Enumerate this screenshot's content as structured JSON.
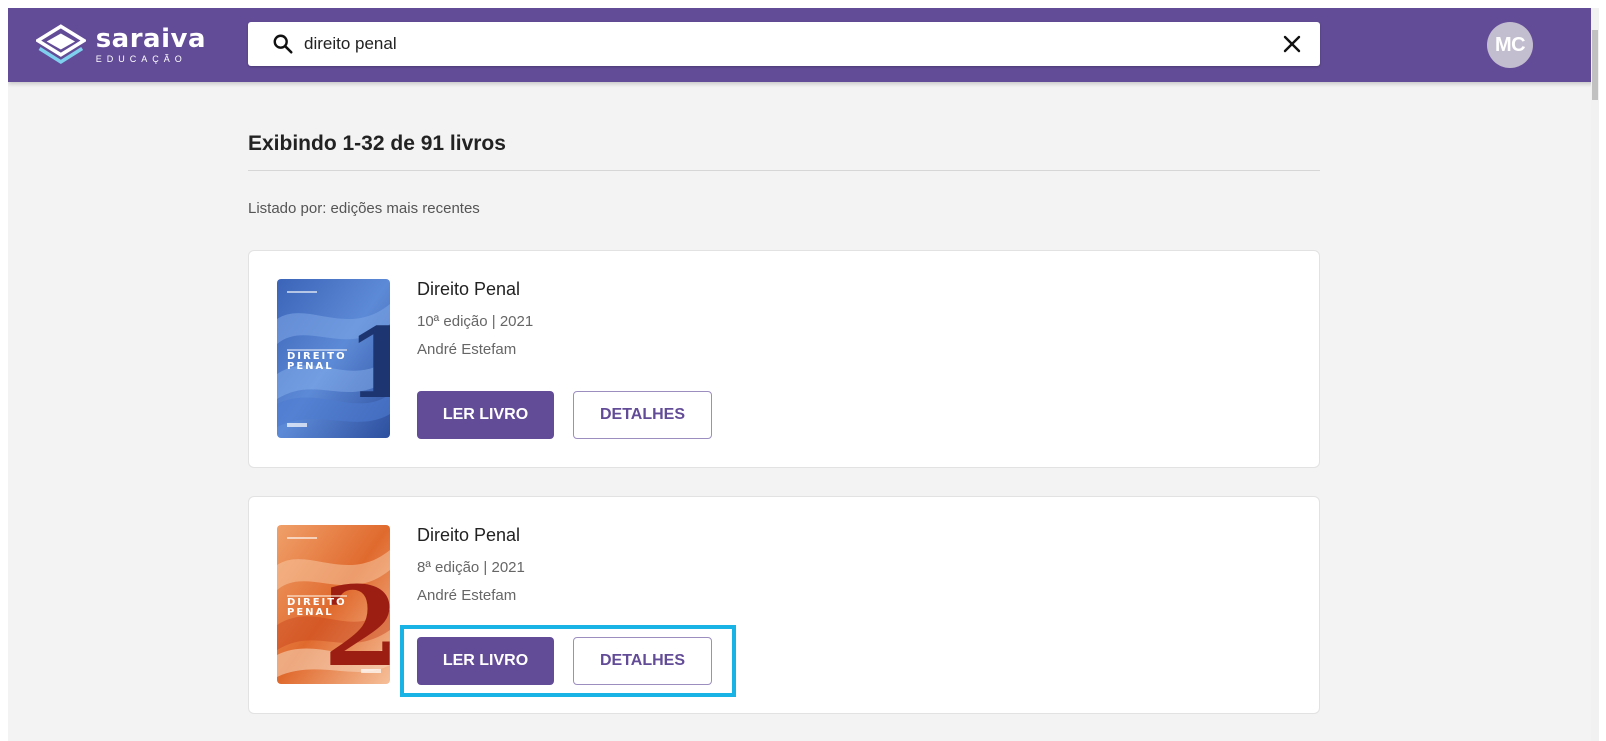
{
  "header": {
    "brand_name": "saraiva",
    "brand_sub": "EDUCAÇÃO",
    "brand_color": "#634c97",
    "search": {
      "value": "direito penal",
      "placeholder": "",
      "icon": "search-icon",
      "clear_icon": "close-icon"
    },
    "avatar_initials": "MC"
  },
  "results": {
    "summary": "Exibindo 1-32 de 91 livros",
    "sort_label": "Listado por: edições mais recentes"
  },
  "books": [
    {
      "title": "Direito Penal",
      "edition": "10ª edição | 2021",
      "author": "André Estefam",
      "cover_number": "1",
      "cover_title_line1": "DIREITO",
      "cover_title_line2": "PENAL",
      "read_label": "LER LIVRO",
      "details_label": "DETALHES"
    },
    {
      "title": "Direito Penal",
      "edition": "8ª edição | 2021",
      "author": "André Estefam",
      "cover_number": "2",
      "cover_title_line1": "DIREITO",
      "cover_title_line2": "PENAL",
      "read_label": "LER LIVRO",
      "details_label": "DETALHES"
    }
  ],
  "highlight_color": "#1ab3e6"
}
